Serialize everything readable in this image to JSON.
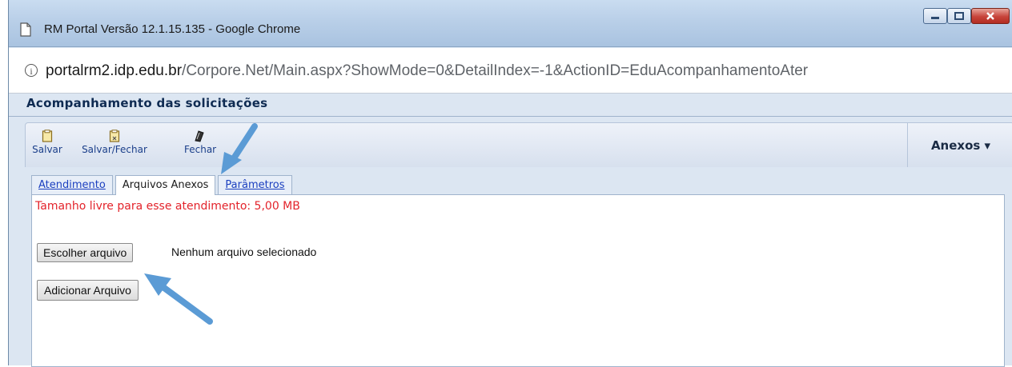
{
  "window": {
    "title": "RM Portal Versão 12.1.15.135 - Google Chrome",
    "url_host": "portalrm2.idp.edu.br",
    "url_path": "/Corpore.Net/Main.aspx?ShowMode=0&DetailIndex=-1&ActionID=EduAcompanhamentoAter"
  },
  "app": {
    "title": "Acompanhamento das solicitações"
  },
  "toolbar": {
    "items": [
      {
        "label": "Salvar",
        "icon": "save-icon"
      },
      {
        "label": "Salvar/Fechar",
        "icon": "save-close-icon"
      },
      {
        "label": "Fechar",
        "icon": "close-book-icon"
      }
    ],
    "anexos_label": "Anexos ▾"
  },
  "tabs": [
    {
      "label": "Atendimento",
      "active": false
    },
    {
      "label": "Arquivos Anexos",
      "active": true
    },
    {
      "label": "Parâmetros",
      "active": false
    }
  ],
  "panel": {
    "free_space_text": "Tamanho livre para esse atendimento: 5,00 MB",
    "choose_file_label": "Escolher arquivo",
    "no_file_text": "Nenhum arquivo selecionado",
    "add_file_label": "Adicionar Arquivo"
  },
  "colors": {
    "warning_text": "#e3232b",
    "link": "#1b3fbf",
    "annotation_arrow": "#5b9bd5"
  }
}
